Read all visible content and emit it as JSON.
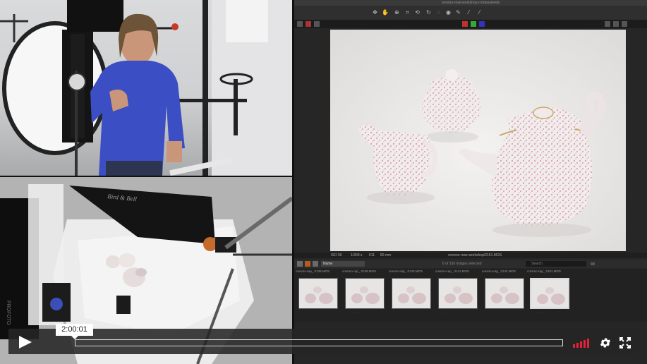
{
  "app": {
    "window_title": "cresmo-rose-workshop-composereds",
    "filename": "cresmo-rose-workshop/2151.MOS",
    "iso": "ISO 50",
    "shutter": "1/300 s",
    "aperture": "f/11",
    "focal": "80 mm"
  },
  "browser": {
    "selected_label": "Name",
    "count_text": "6 of 150 images selected",
    "search_placeholder": "Search",
    "thumbs": [
      {
        "name": "cresmo-rap_  0138.MOS"
      },
      {
        "name": "cresmo-rap_  0139.MOS"
      },
      {
        "name": "cresmo-rap_  0140.MOS"
      },
      {
        "name": "cresmo-rap_  0141.MOS"
      },
      {
        "name": "cresmo-rap_  0142.MOS"
      },
      {
        "name": "cresmo-rap_  0151.MOS"
      }
    ]
  },
  "player": {
    "time_tooltip": "2:00:01",
    "progress": 0.0,
    "volume_level": 1.0,
    "accent": "#e8213a"
  }
}
